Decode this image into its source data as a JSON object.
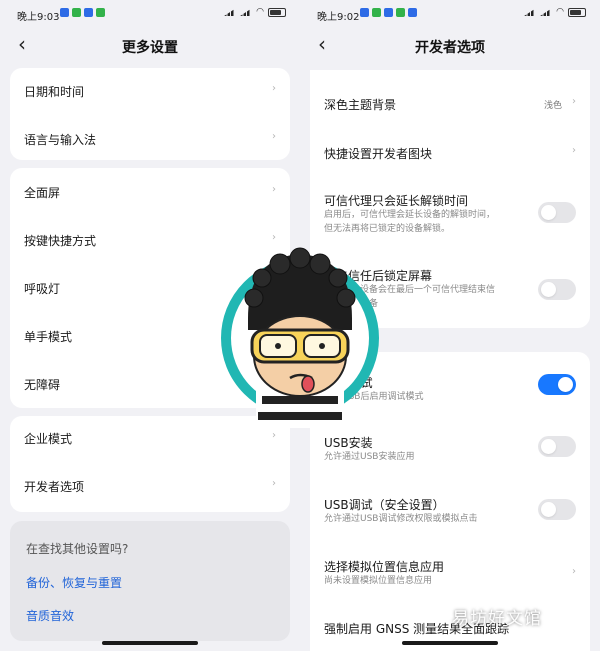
{
  "left": {
    "status": {
      "time": "晚上9:03"
    },
    "title": "更多设置",
    "group1": [
      {
        "label": "日期和时间"
      },
      {
        "label": "语言与输入法"
      }
    ],
    "group2": [
      {
        "label": "全面屏"
      },
      {
        "label": "按键快捷方式"
      },
      {
        "label": "呼吸灯"
      },
      {
        "label": "单手模式"
      },
      {
        "label": "无障碍"
      }
    ],
    "group3": [
      {
        "label": "企业模式"
      },
      {
        "label": "开发者选项"
      }
    ],
    "search": {
      "question": "在查找其他设置吗?",
      "links": [
        "备份、恢复与重置",
        "音质音效"
      ]
    }
  },
  "right": {
    "status": {
      "time": "晚上9:02"
    },
    "title": "开发者选项",
    "items_top": [
      {
        "label": "深色主题背景",
        "value": "浅色"
      },
      {
        "label": "快捷设置开发者图块"
      }
    ],
    "trust": {
      "label": "可信代理只会延长解锁时间",
      "desc1": "启用后，可信代理会延长设备的解锁时间，",
      "desc2": "但无法再将已锁定的设备解锁。"
    },
    "lock": {
      "label": "失去信任后锁定屏幕",
      "desc1": "启用后，设备会在最后一个可信代理结束信",
      "desc2": "任时锁定设备"
    },
    "usb_debug": {
      "label": "USB调试",
      "desc": "连接USB后启用调试模式"
    },
    "usb_install": {
      "label": "USB安装",
      "desc": "允许通过USB安装应用"
    },
    "usb_secure": {
      "label": "USB调试（安全设置）",
      "desc": "允许通过USB调试修改权限或模拟点击"
    },
    "mock": {
      "label": "选择模拟位置信息应用",
      "desc": "尚未设置模拟位置信息应用"
    },
    "gnss": {
      "label": "强制启用 GNSS 测量结果全面跟踪"
    }
  },
  "watermark": "易坊好文馆",
  "toggles": {
    "trust": false,
    "lock": false,
    "usb_debug": true,
    "usb_install": false,
    "usb_secure": false
  },
  "colors": {
    "accent": "#1878ff",
    "link": "#2164d8",
    "mascot_ring": "#21b7b3"
  },
  "icons": [
    "back-arrow-icon",
    "chevron-right-icon",
    "battery-icon",
    "wifi-icon",
    "signal-icon"
  ]
}
